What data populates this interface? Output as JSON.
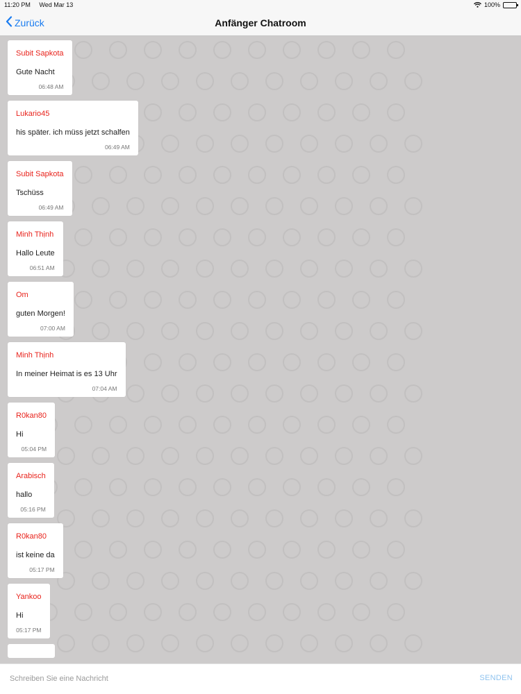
{
  "status_bar": {
    "time": "11:20 PM",
    "date": "Wed Mar 13",
    "battery": "100%",
    "icons": [
      "wifi-icon",
      "battery-icon"
    ]
  },
  "nav": {
    "back_label": "Zurück",
    "title": "Anfänger Chatroom",
    "back_icon": "chevron-left-icon",
    "accent_color": "#1a7cf0"
  },
  "chat": {
    "background_color": "#cdcbcb",
    "sender_color": "#e8221b",
    "messages": [
      {
        "sender": "Subit Sapkota",
        "text": "Gute Nacht",
        "time": "06:48 AM"
      },
      {
        "sender": "Lukario45",
        "text": "his später. ich müss jetzt schalfen",
        "time": "06:49 AM"
      },
      {
        "sender": "Subit Sapkota",
        "text": "Tschüss",
        "time": "06:49 AM"
      },
      {
        "sender": "Minh Thịnh",
        "text": "Hallo Leute",
        "time": "06:51 AM"
      },
      {
        "sender": "Om",
        "text": "guten Morgen!",
        "time": "07:00 AM"
      },
      {
        "sender": "Minh Thịnh",
        "text": "In meiner Heimat is es 13 Uhr",
        "time": "07:04 AM"
      },
      {
        "sender": "R0kan80",
        "text": "Hi",
        "time": "05:04 PM"
      },
      {
        "sender": "Arabisch",
        "text": "hallo",
        "time": "05:16 PM"
      },
      {
        "sender": "R0kan80",
        "text": "ist keine da",
        "time": "05:17 PM"
      },
      {
        "sender": "Yankoo",
        "text": "Hi",
        "time": "05:17 PM"
      }
    ]
  },
  "composer": {
    "placeholder": "Schreiben Sie eine Nachricht",
    "value": "",
    "send_label": "SENDEN",
    "send_color": "#8fc3ef"
  }
}
